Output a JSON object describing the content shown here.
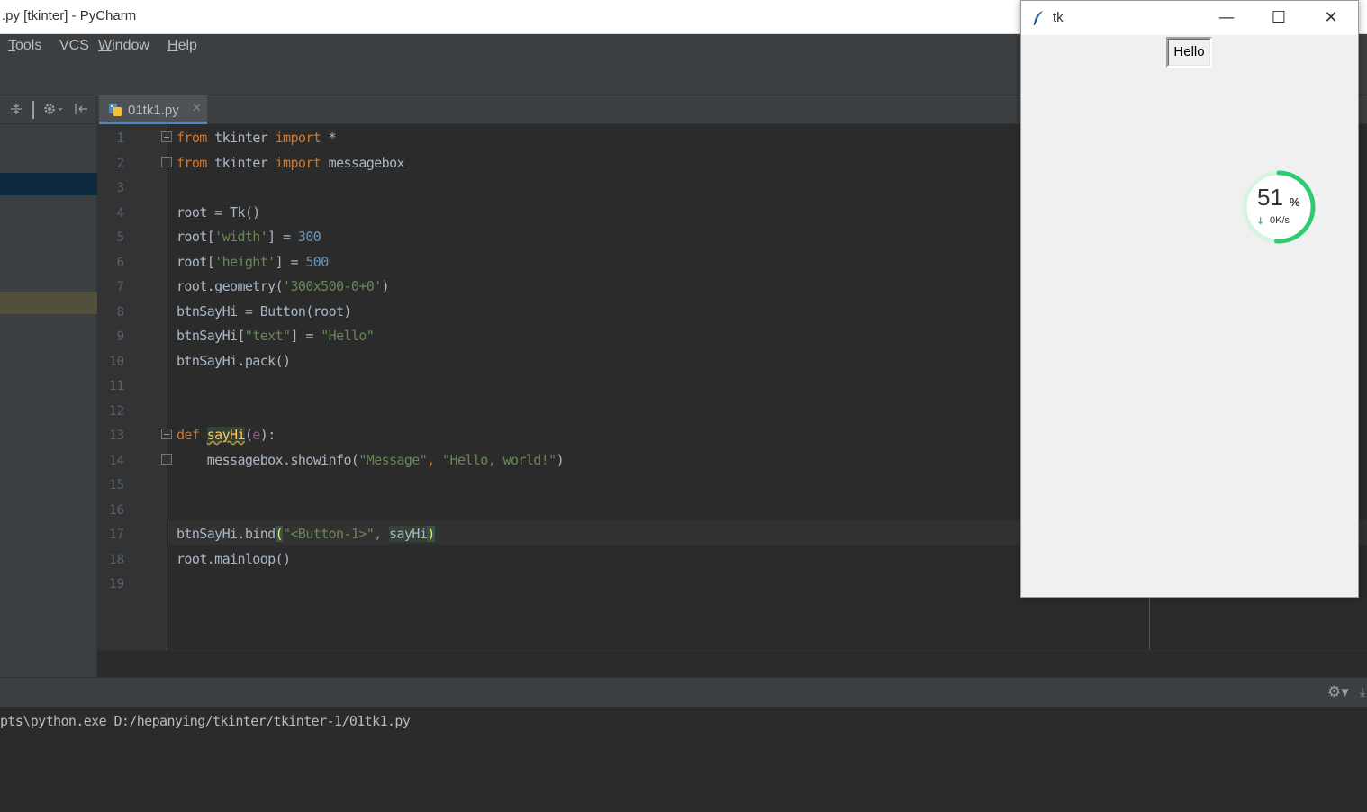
{
  "ide": {
    "window_title": ".py [tkinter] - PyCharm",
    "menu": [
      "Tools",
      "VCS",
      "Window",
      "Help"
    ],
    "tab_name": "01tk1.py",
    "line_numbers": [
      "1",
      "2",
      "3",
      "4",
      "5",
      "6",
      "7",
      "8",
      "9",
      "10",
      "11",
      "12",
      "13",
      "14",
      "15",
      "16",
      "17",
      "18",
      "19"
    ],
    "code": {
      "l1": {
        "a": "from",
        "b": " tkinter ",
        "c": "import",
        "d": " *"
      },
      "l2": {
        "a": "from",
        "b": " tkinter ",
        "c": "import",
        "d": " messagebox"
      },
      "l4": "root = Tk()",
      "l5": {
        "a": "root[",
        "b": "'width'",
        "c": "] = ",
        "d": "300"
      },
      "l6": {
        "a": "root[",
        "b": "'height'",
        "c": "] = ",
        "d": "500"
      },
      "l7": {
        "a": "root.geometry(",
        "b": "'300x500-0+0'",
        "c": ")"
      },
      "l8": "btnSayHi = Button(root)",
      "l9": {
        "a": "btnSayHi[",
        "b": "\"text\"",
        "c": "] = ",
        "d": "\"Hello\""
      },
      "l10": "btnSayHi.pack()",
      "l13": {
        "a": "def",
        "b": " ",
        "c": "sayHi",
        "d": "(",
        "e": "e",
        "f": "):"
      },
      "l14": {
        "a": "    messagebox.showinfo(",
        "b": "\"Message\"",
        "c": ", ",
        "d": "\"Hello, world!\"",
        "e": ")"
      },
      "l17": {
        "a": "btnSayHi.bind",
        "b": "(",
        "c": "\"<Button-1>\"",
        "d": ", ",
        "e": "sayHi",
        "f": ")"
      },
      "l18": "root.mainloop()"
    },
    "run_output": "pts\\python.exe D:/hepanying/tkinter/tkinter-1/01tk1.py"
  },
  "tk": {
    "title": "tk",
    "button_text": "Hello",
    "minimize": "—",
    "maximize": "☐",
    "close": "✕"
  },
  "net_widget": {
    "percent": "51",
    "percent_sign": "%",
    "speed": "0K/s",
    "ring_color": "#2ecc71"
  },
  "colors": {
    "keyword": "#cc7832",
    "string": "#6a8759",
    "number": "#6897bb",
    "function": "#ffc66d"
  }
}
